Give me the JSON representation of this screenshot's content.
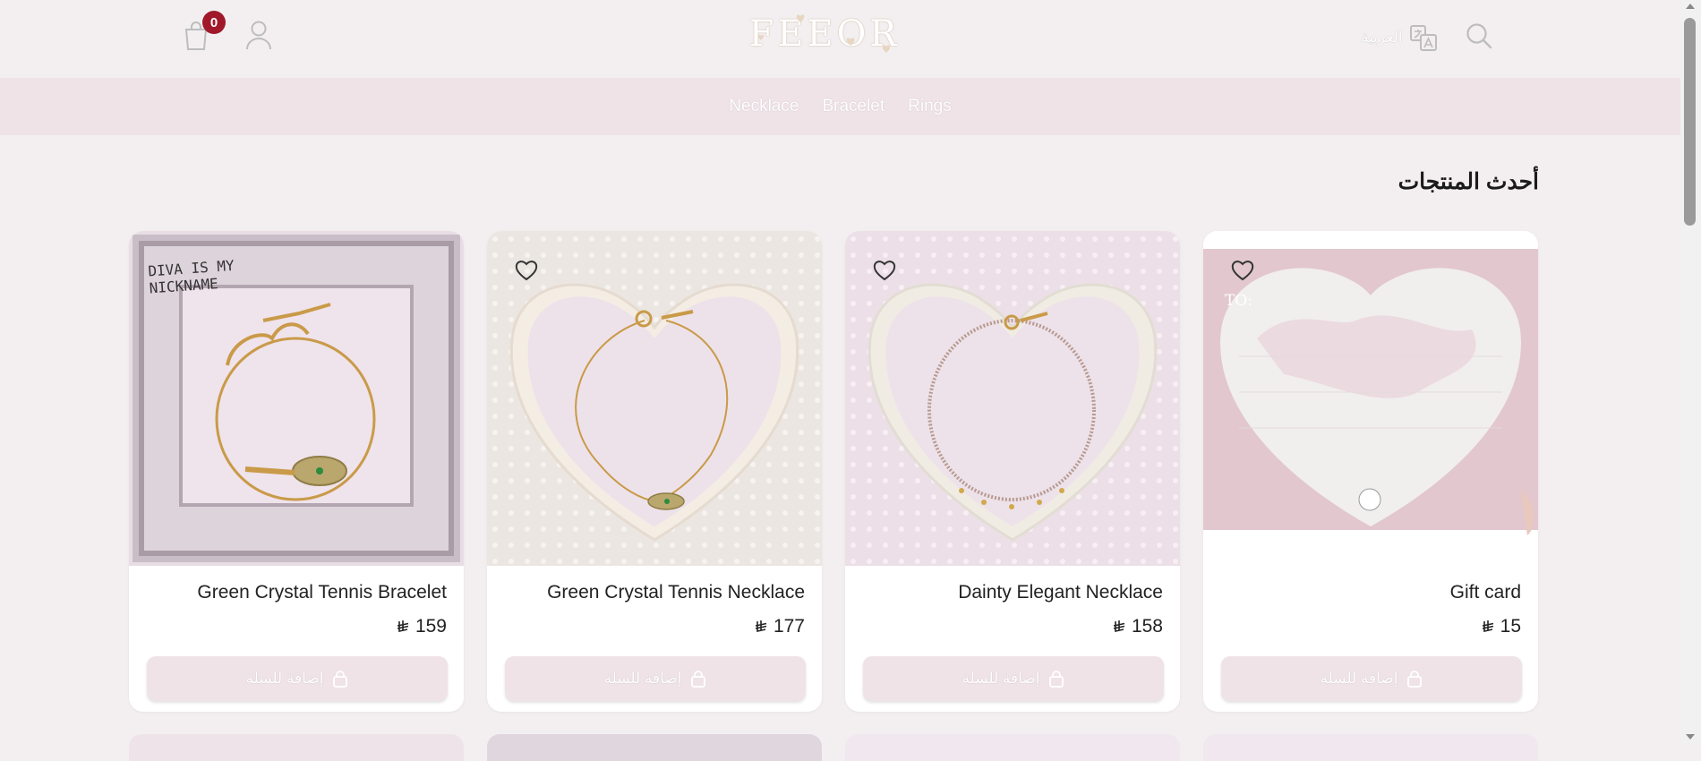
{
  "header": {
    "cart_count": "0",
    "logo_text": "FEEOR",
    "language_label": "العربية"
  },
  "icons": {
    "cart": "shopping-bag-icon",
    "account": "user-icon",
    "language": "translate-icon",
    "search": "search-icon",
    "wishlist": "heart-icon",
    "add_to_cart": "lock-bag-icon",
    "currency": "riyal-icon"
  },
  "nav": {
    "items": [
      {
        "label": "Necklace"
      },
      {
        "label": "Bracelet"
      },
      {
        "label": "Rings"
      }
    ]
  },
  "section": {
    "title": "أحدث المنتجات"
  },
  "products": [
    {
      "name": "Gift card",
      "price": "15",
      "add_label": "إضافة للسلة",
      "image_caption": "TO:"
    },
    {
      "name": "Dainty Elegant Necklace",
      "price": "158",
      "add_label": "إضافة للسلة"
    },
    {
      "name": "Green Crystal Tennis Necklace",
      "price": "177",
      "add_label": "إضافة للسلة"
    },
    {
      "name": "Green Crystal Tennis Bracelet",
      "price": "159",
      "add_label": "إضافة للسلة",
      "image_caption": "DIVA IS MY NICKNAME"
    }
  ],
  "colors": {
    "page_bg": "#f3eff1",
    "nav_bg": "#efe3e8",
    "badge": "#a0182a",
    "button_bg": "#efe3e8"
  }
}
